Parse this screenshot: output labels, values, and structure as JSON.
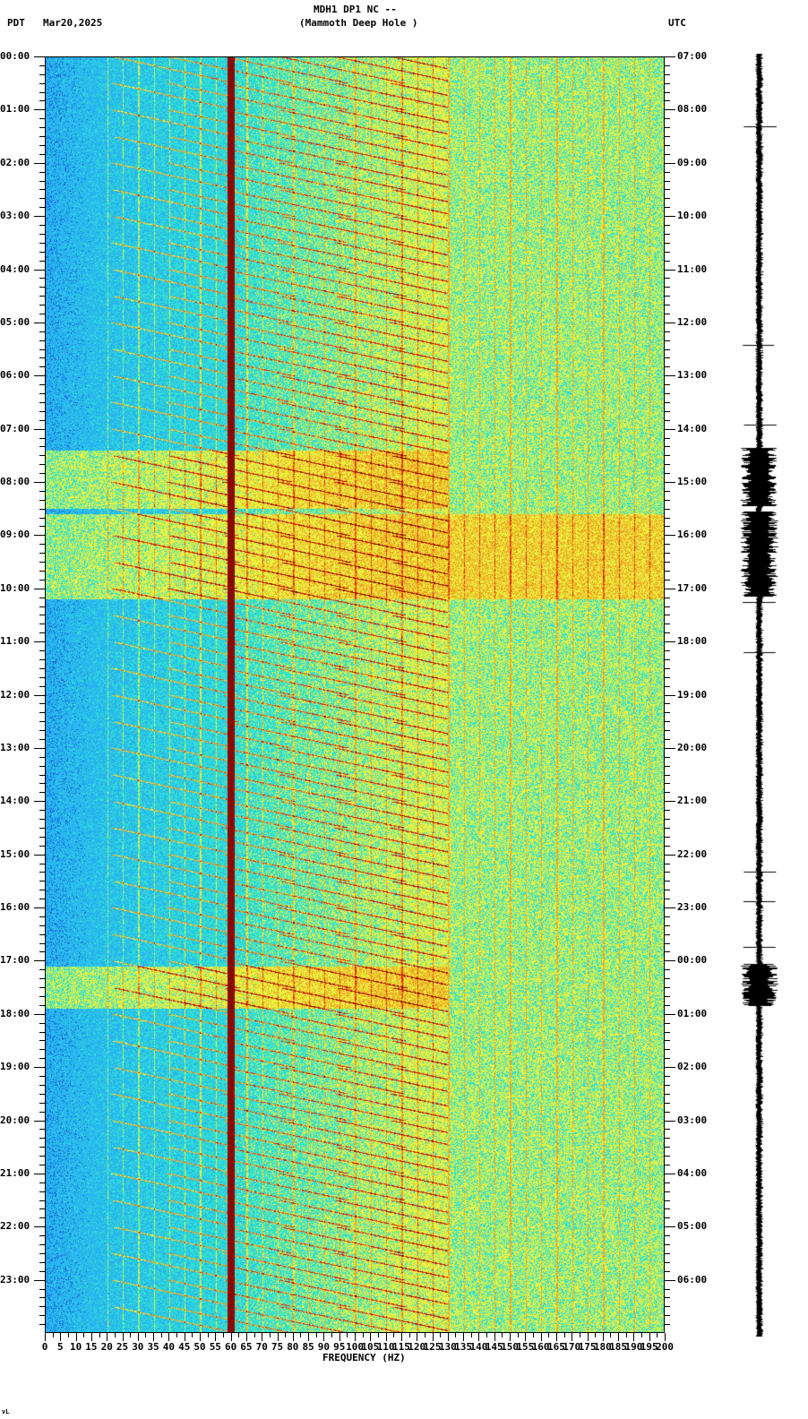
{
  "header": {
    "title": "MDH1 DP1 NC --",
    "subtitle": "(Mammoth Deep Hole )",
    "left_tz": "PDT",
    "date": "Mar20,2025",
    "right_tz": "UTC"
  },
  "chart_data": {
    "type": "heatmap",
    "title": "MDH1 DP1 NC -- (Mammoth Deep Hole )",
    "xlabel": "FREQUENCY (HZ)",
    "xlim": [
      0,
      200
    ],
    "x_ticks": [
      "0",
      "5",
      "10",
      "15",
      "20",
      "25",
      "30",
      "35",
      "40",
      "45",
      "50",
      "55",
      "60",
      "65",
      "70",
      "75",
      "80",
      "85",
      "90",
      "95",
      "100",
      "105",
      "110",
      "115",
      "120",
      "125",
      "130",
      "135",
      "140",
      "145",
      "150",
      "155",
      "160",
      "165",
      "170",
      "175",
      "180",
      "185",
      "190",
      "195",
      "200"
    ],
    "y_left_label": "PDT",
    "y_left_ticks": [
      "00:00",
      "01:00",
      "02:00",
      "03:00",
      "04:00",
      "05:00",
      "06:00",
      "07:00",
      "08:00",
      "09:00",
      "10:00",
      "11:00",
      "12:00",
      "13:00",
      "14:00",
      "15:00",
      "16:00",
      "17:00",
      "18:00",
      "19:00",
      "20:00",
      "21:00",
      "22:00",
      "23:00"
    ],
    "y_right_label": "UTC",
    "y_right_ticks": [
      "07:00",
      "08:00",
      "09:00",
      "10:00",
      "11:00",
      "12:00",
      "13:00",
      "14:00",
      "15:00",
      "16:00",
      "17:00",
      "18:00",
      "19:00",
      "20:00",
      "21:00",
      "22:00",
      "23:00",
      "00:00",
      "01:00",
      "02:00",
      "03:00",
      "04:00",
      "05:00",
      "06:00"
    ],
    "ylim_hours": [
      0,
      24
    ],
    "features": {
      "power_line_hz": 60,
      "high_energy_periods_pdt_hours": [
        [
          7.4,
          8.5
        ],
        [
          8.6,
          10.2
        ],
        [
          17.1,
          17.9
        ]
      ]
    },
    "colormap": [
      "#1e5bd8",
      "#27b4f0",
      "#32e0d0",
      "#e8f040",
      "#f0a020",
      "#e02010",
      "#8a0a00"
    ]
  },
  "footer_mark": "vL"
}
